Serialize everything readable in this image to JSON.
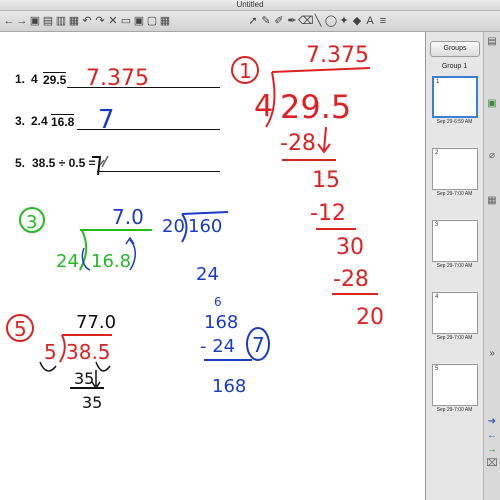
{
  "window": {
    "title": "Untitled"
  },
  "toolbar": {
    "tools": [
      {
        "name": "previous-page-icon",
        "glyph": "←"
      },
      {
        "name": "next-page-icon",
        "glyph": "→"
      },
      {
        "name": "add-page-icon",
        "glyph": "▣"
      },
      {
        "name": "open-file-icon",
        "glyph": "▤"
      },
      {
        "name": "save-icon",
        "glyph": "▥"
      },
      {
        "name": "paste-icon",
        "glyph": "▦"
      },
      {
        "name": "undo-icon",
        "glyph": "↶"
      },
      {
        "name": "redo-icon",
        "glyph": "↷"
      },
      {
        "name": "delete-icon",
        "glyph": "✕"
      },
      {
        "name": "screen-shade-icon",
        "glyph": "▭"
      },
      {
        "name": "display-icon",
        "glyph": "▣"
      },
      {
        "name": "capture-icon",
        "glyph": "▢"
      },
      {
        "name": "table-icon",
        "glyph": "▦"
      },
      {
        "name": "select-icon",
        "glyph": "➚"
      },
      {
        "name": "pen-icon",
        "glyph": "✎"
      },
      {
        "name": "creative-pen-icon",
        "glyph": "✐"
      },
      {
        "name": "highlighter-icon",
        "glyph": "✒"
      },
      {
        "name": "eraser-icon",
        "glyph": "⌫"
      },
      {
        "name": "line-icon",
        "glyph": "╲"
      },
      {
        "name": "shapes-icon",
        "glyph": "◯"
      },
      {
        "name": "magic-pen-icon",
        "glyph": "✦"
      },
      {
        "name": "fill-icon",
        "glyph": "◆"
      },
      {
        "name": "text-icon",
        "glyph": "A"
      },
      {
        "name": "properties-icon",
        "glyph": "≡"
      }
    ]
  },
  "sidebar": {
    "groups_button": "Groups",
    "group_label": "Group 1",
    "pages": [
      {
        "number": "1",
        "date": "Sep 29-6:59 AM"
      },
      {
        "number": "2",
        "date": "Sep 29-7:00 AM"
      },
      {
        "number": "3",
        "date": "Sep 29-7:00 AM"
      },
      {
        "number": "4",
        "date": "Sep 29-7:00 AM"
      },
      {
        "number": "5",
        "date": "Sep 29-7:00 AM"
      }
    ]
  },
  "problems": {
    "p1": {
      "num": "1.",
      "dividend": "29.5",
      "divisor": "4"
    },
    "p3": {
      "num": "3.",
      "dividend": "16.8",
      "divisor": "2.4"
    },
    "p5": {
      "num": "5.",
      "text": "38.5 ÷ 0.5 ="
    }
  },
  "ink": {
    "answer1": "7.375",
    "answer3": "7",
    "circle1": "1",
    "work1_top": "7.375",
    "work1_divisor": "4",
    "work1_dividend": "29.5",
    "work1_s1": "-28",
    "work1_r1": "15",
    "work1_s2": "-12",
    "work1_r2": "30",
    "work1_s3": "-28",
    "work1_r3": "20",
    "circle3": "3",
    "work3_top": "7.0",
    "work3_divisor": "24",
    "work3_dividend": "16.8",
    "work3b_divisor": "20",
    "work3b_dividend": "160",
    "work3b_guess": "24",
    "work3c_small": "6",
    "work3c_top": "168",
    "work3c_sub": "- 24",
    "work3c_result": "168",
    "work3c_circle": "7",
    "circle5": "5",
    "work5_top": "77.0",
    "work5_divisor": "5",
    "work5_dividend": "38.5",
    "work5_sub": "35",
    "work5_rem": "35"
  }
}
